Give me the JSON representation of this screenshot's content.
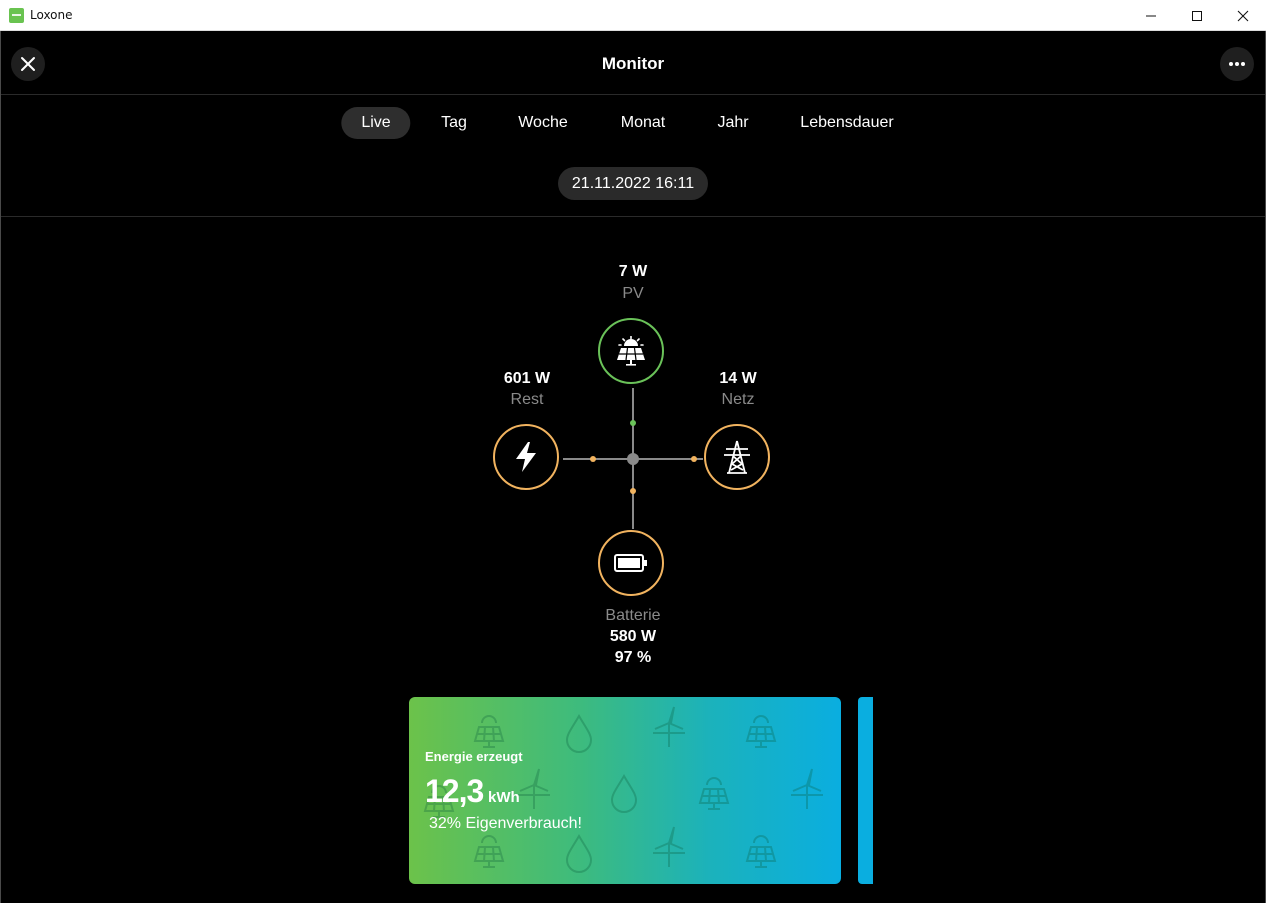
{
  "window": {
    "title": "Loxone"
  },
  "header": {
    "title": "Monitor"
  },
  "tabs": [
    {
      "label": "Live",
      "active": true
    },
    {
      "label": "Tag",
      "active": false
    },
    {
      "label": "Woche",
      "active": false
    },
    {
      "label": "Monat",
      "active": false
    },
    {
      "label": "Jahr",
      "active": false
    },
    {
      "label": "Lebensdauer",
      "active": false
    }
  ],
  "date": "21.11.2022 16:11",
  "flow": {
    "pv": {
      "value": "7  W",
      "label": "PV",
      "icon": "solar-panel-icon"
    },
    "rest": {
      "value": "601  W",
      "label": "Rest",
      "icon": "lightning-icon"
    },
    "netz": {
      "value": "14  W",
      "label": "Netz",
      "icon": "power-pylon-icon"
    },
    "batterie": {
      "label": "Batterie",
      "value": "580  W",
      "percent": "97 %",
      "icon": "battery-icon"
    }
  },
  "colors": {
    "pv": "#6ac259",
    "flow": "#f1b35f",
    "line": "#8a8a8a"
  },
  "card": {
    "title": "Energie erzeugt",
    "value": "12,3",
    "unit": "kWh",
    "subtitle": "32% Eigenverbrauch!"
  }
}
